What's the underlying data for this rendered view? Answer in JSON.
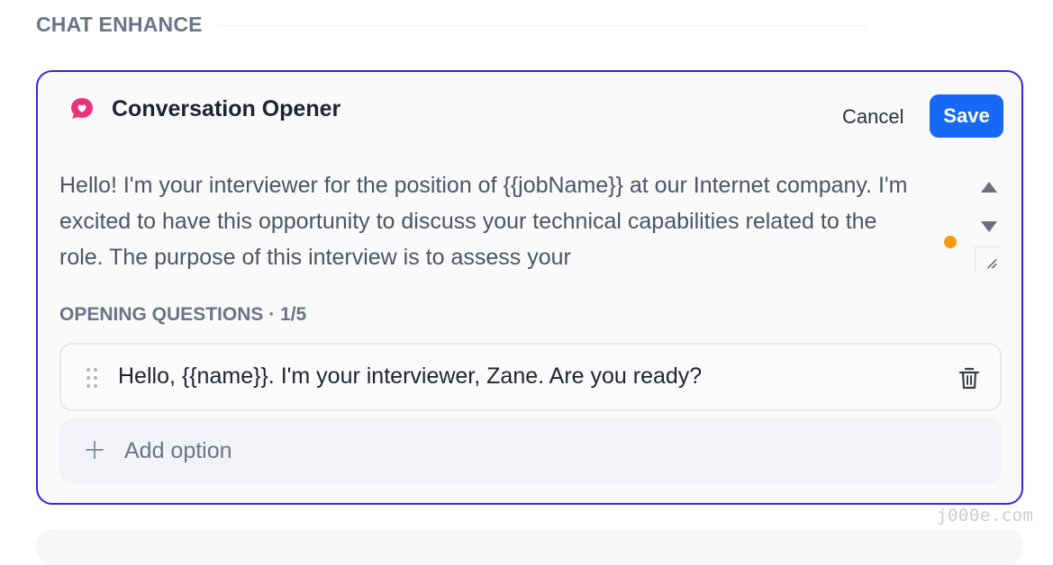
{
  "section": {
    "title": "CHAT ENHANCE"
  },
  "card": {
    "icon": "chat-heart-icon",
    "title": "Conversation Opener",
    "cancel_label": "Cancel",
    "save_label": "Save",
    "opener_text": "Hello! I'm your interviewer for the position of {{jobName}} at our Internet company. I'm excited to have this opportunity to discuss your technical capabilities related to the role. The purpose of this interview is to assess your",
    "questions_heading": "OPENING QUESTIONS · 1/5",
    "questions": [
      {
        "text": "Hello, {{name}}. I'm your interviewer, Zane. Are you ready?"
      }
    ],
    "add_option_label": "Add option"
  },
  "watermark": "j000e.com",
  "colors": {
    "accent_border": "#3a22e6",
    "save_button": "#1769f5",
    "icon_pink": "#e8337a",
    "status_dot": "#f39c12"
  }
}
